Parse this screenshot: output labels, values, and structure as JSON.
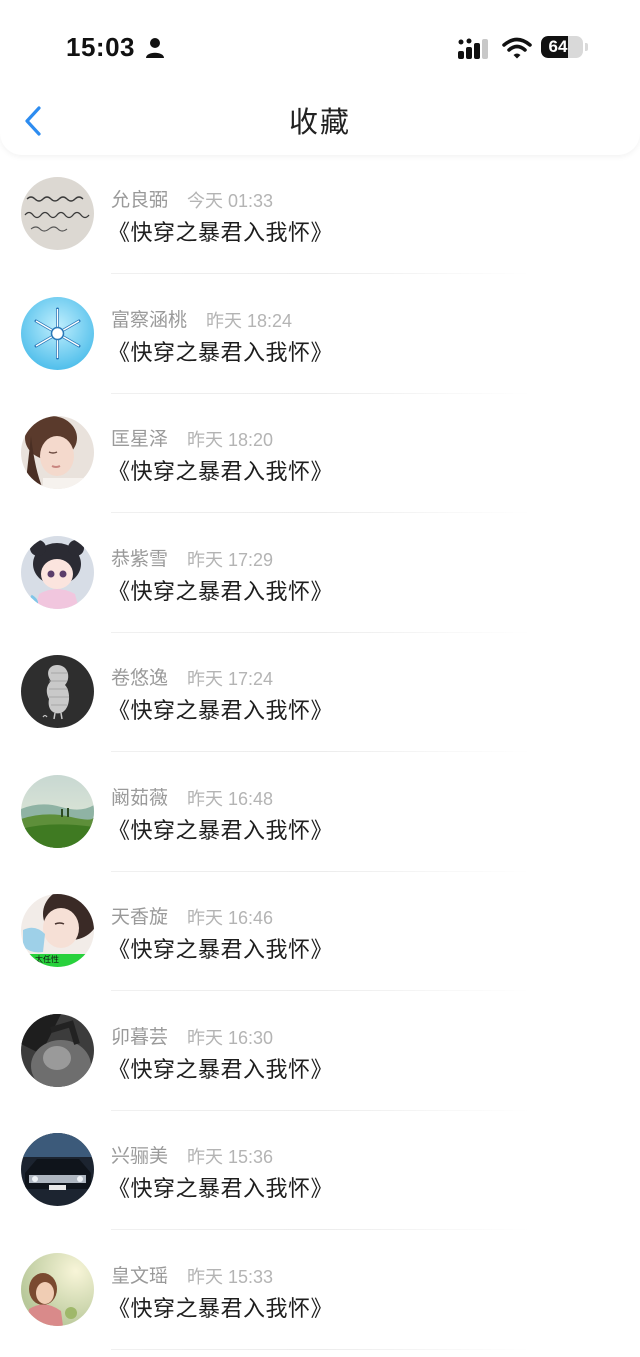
{
  "status_bar": {
    "time": "15:03",
    "battery": "64",
    "battery_level": 0.64
  },
  "header": {
    "title": "收藏"
  },
  "items": [
    {
      "name": "允良弼",
      "time": "今天 01:33",
      "title": "《快穿之暴君入我怀》",
      "avatar": "handwriting-avatar"
    },
    {
      "name": "富察涵桃",
      "time": "昨天 18:24",
      "title": "《快穿之暴君入我怀》",
      "avatar": "snowflake-avatar"
    },
    {
      "name": "匡星泽",
      "time": "昨天 18:20",
      "title": "《快穿之暴君入我怀》",
      "avatar": "portrait-avatar"
    },
    {
      "name": "恭紫雪",
      "time": "昨天 17:29",
      "title": "《快穿之暴君入我怀》",
      "avatar": "anime-girl-avatar"
    },
    {
      "name": "卷悠逸",
      "time": "昨天 17:24",
      "title": "《快穿之暴君入我怀》",
      "avatar": "peanut-avatar"
    },
    {
      "name": "阚茹薇",
      "time": "昨天 16:48",
      "title": "《快穿之暴君入我怀》",
      "avatar": "landscape-avatar"
    },
    {
      "name": "天香旋",
      "time": "昨天 16:46",
      "title": "《快穿之暴君入我怀》",
      "avatar": "masked-girl-avatar"
    },
    {
      "name": "卯暮芸",
      "time": "昨天 16:30",
      "title": "《快穿之暴君入我怀》",
      "avatar": "monochrome-avatar"
    },
    {
      "name": "兴骊美",
      "time": "昨天 15:36",
      "title": "《快穿之暴君入我怀》",
      "avatar": "car-avatar"
    },
    {
      "name": "皇文瑶",
      "time": "昨天 15:33",
      "title": "《快穿之暴君入我怀》",
      "avatar": "sunlit-girl-avatar"
    }
  ],
  "colors": {
    "accent": "#2d8cf0",
    "name_text": "#9a9a9a",
    "time_text": "#b4b4b4"
  }
}
